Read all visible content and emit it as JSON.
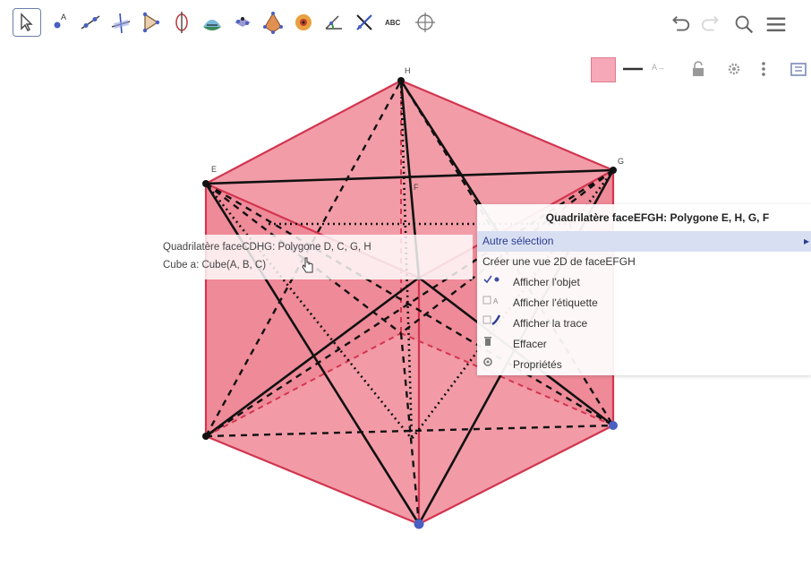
{
  "toolbar": {
    "tools": [
      {
        "icon": "move-arrow-icon",
        "selected": true
      },
      {
        "icon": "point-icon"
      },
      {
        "icon": "line-icon"
      },
      {
        "icon": "perpendicular-line-icon"
      },
      {
        "icon": "polygon-icon"
      },
      {
        "icon": "circle-axis-icon"
      },
      {
        "icon": "intersect-two-surfaces-icon"
      },
      {
        "icon": "plane-icon"
      },
      {
        "icon": "pyramid-icon"
      },
      {
        "icon": "sphere-icon"
      },
      {
        "icon": "angle-icon"
      },
      {
        "icon": "reflect-icon"
      },
      {
        "icon": "text-tool-icon",
        "label": "ABC"
      },
      {
        "icon": "rotate-view-icon"
      }
    ],
    "right_icons": [
      "undo-icon",
      "redo-icon",
      "search-icon",
      "menu-icon"
    ],
    "style_bar": [
      "color-swatch-icon",
      "line-style-icon",
      "label-style-icon",
      "lock-icon",
      "gear-icon",
      "more-vertical-icon",
      "graphics-view-icon"
    ],
    "style_label": "A→"
  },
  "points": {
    "E": "E",
    "F": "F",
    "G": "G",
    "H": "H"
  },
  "tooltip": {
    "line1": "Quadrilatère faceCDHG: Polygone D, C, G, H",
    "line2": "Cube a: Cube(A, B, C)"
  },
  "context_menu": {
    "title": "Quadrilatère faceEFGH: Polygone E, H, G, F",
    "items": [
      {
        "label": "Autre sélection",
        "highlight": true,
        "submenu": true
      },
      {
        "label": "Créer une vue 2D de faceEFGH"
      },
      {
        "label": "Afficher l'objet",
        "icon": "show-object-icon"
      },
      {
        "label": "Afficher l'étiquette",
        "icon": "show-label-icon"
      },
      {
        "label": "Afficher la trace",
        "icon": "trace-icon"
      },
      {
        "label": "Effacer",
        "icon": "trash-icon"
      },
      {
        "label": "Propriétés",
        "icon": "gear-icon"
      }
    ]
  },
  "colors": {
    "face_fill": "#e8485e",
    "edge": "#d2354f",
    "accent": "#6a7fa8",
    "point_blue": "#4a5fc1"
  }
}
